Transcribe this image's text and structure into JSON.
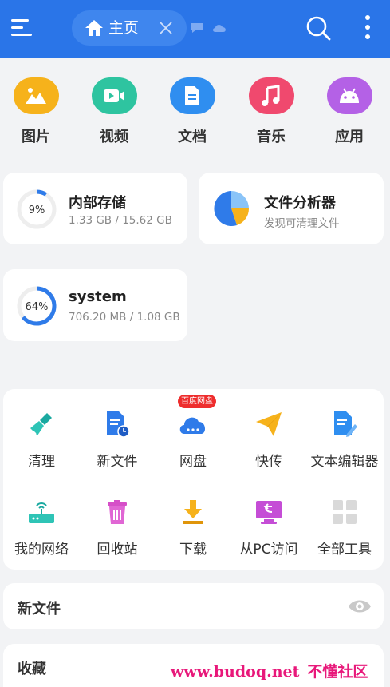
{
  "topbar": {
    "tab_label": "主页",
    "menu_icon": "hamburger-menu-icon",
    "home_icon": "home-icon",
    "close_icon": "close-icon",
    "search_icon": "search-icon",
    "more_icon": "more-vertical-icon",
    "accent": "#2a75e8"
  },
  "categories": [
    {
      "label": "图片",
      "icon": "image-icon",
      "color": "#f6b21b"
    },
    {
      "label": "视频",
      "icon": "video-icon",
      "color": "#2ec4a0"
    },
    {
      "label": "文档",
      "icon": "document-icon",
      "color": "#2f8ef0"
    },
    {
      "label": "音乐",
      "icon": "music-icon",
      "color": "#f0496e"
    },
    {
      "label": "应用",
      "icon": "android-icon",
      "color": "#b461e6"
    }
  ],
  "storage": [
    {
      "title": "内部存储",
      "percent_label": "9%",
      "percent": 9,
      "usage": "1.33 GB / 15.62 GB"
    },
    {
      "title": "system",
      "percent_label": "64%",
      "percent": 64,
      "usage": "706.20 MB / 1.08 GB"
    }
  ],
  "analyzer": {
    "title": "文件分析器",
    "subtitle": "发现可清理文件",
    "icon": "pie-chart-icon"
  },
  "tools": {
    "badge": "百度网盘",
    "items": [
      {
        "label": "清理",
        "icon": "broom-icon"
      },
      {
        "label": "新文件",
        "icon": "new-file-icon"
      },
      {
        "label": "网盘",
        "icon": "cloud-drive-icon"
      },
      {
        "label": "快传",
        "icon": "paper-plane-icon"
      },
      {
        "label": "文本编辑器",
        "icon": "text-editor-icon"
      },
      {
        "label": "我的网络",
        "icon": "router-icon"
      },
      {
        "label": "回收站",
        "icon": "trash-icon"
      },
      {
        "label": "下载",
        "icon": "download-icon"
      },
      {
        "label": "从PC访问",
        "icon": "pc-access-icon"
      },
      {
        "label": "全部工具",
        "icon": "grid-icon"
      }
    ]
  },
  "sections": {
    "new_files": {
      "title": "新文件",
      "icon": "eye-icon"
    },
    "favorites": {
      "title": "收藏"
    }
  },
  "watermark": {
    "site": "www.budoq.net",
    "name": "不懂社区"
  }
}
